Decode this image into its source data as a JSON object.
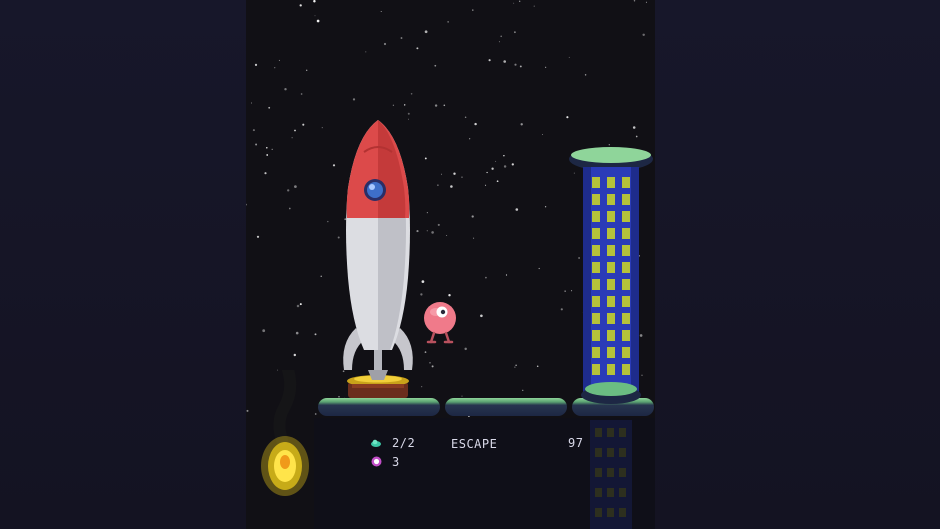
{
  "hud": {
    "ships": {
      "icon": "alien-ship-icon",
      "value": "2/2"
    },
    "orbs": {
      "icon": "pink-orb-icon",
      "value": "3"
    },
    "objective": "ESCAPE",
    "score": "97"
  },
  "scene": {
    "rocket": {
      "icon": "rocket-icon",
      "body_color": "#d9d9de",
      "nose_color": "#dc4a4a"
    },
    "player": {
      "icon": "pink-blob-creature-icon",
      "color": "#f07a8a"
    },
    "tower": {
      "icon": "tower-icon",
      "color": "#2a3bb8",
      "window_color": "#b5c23a"
    },
    "flame": {
      "icon": "fire-icon",
      "color": "#f4d21a"
    },
    "platform_color": "#5aa271",
    "background": "starfield"
  }
}
